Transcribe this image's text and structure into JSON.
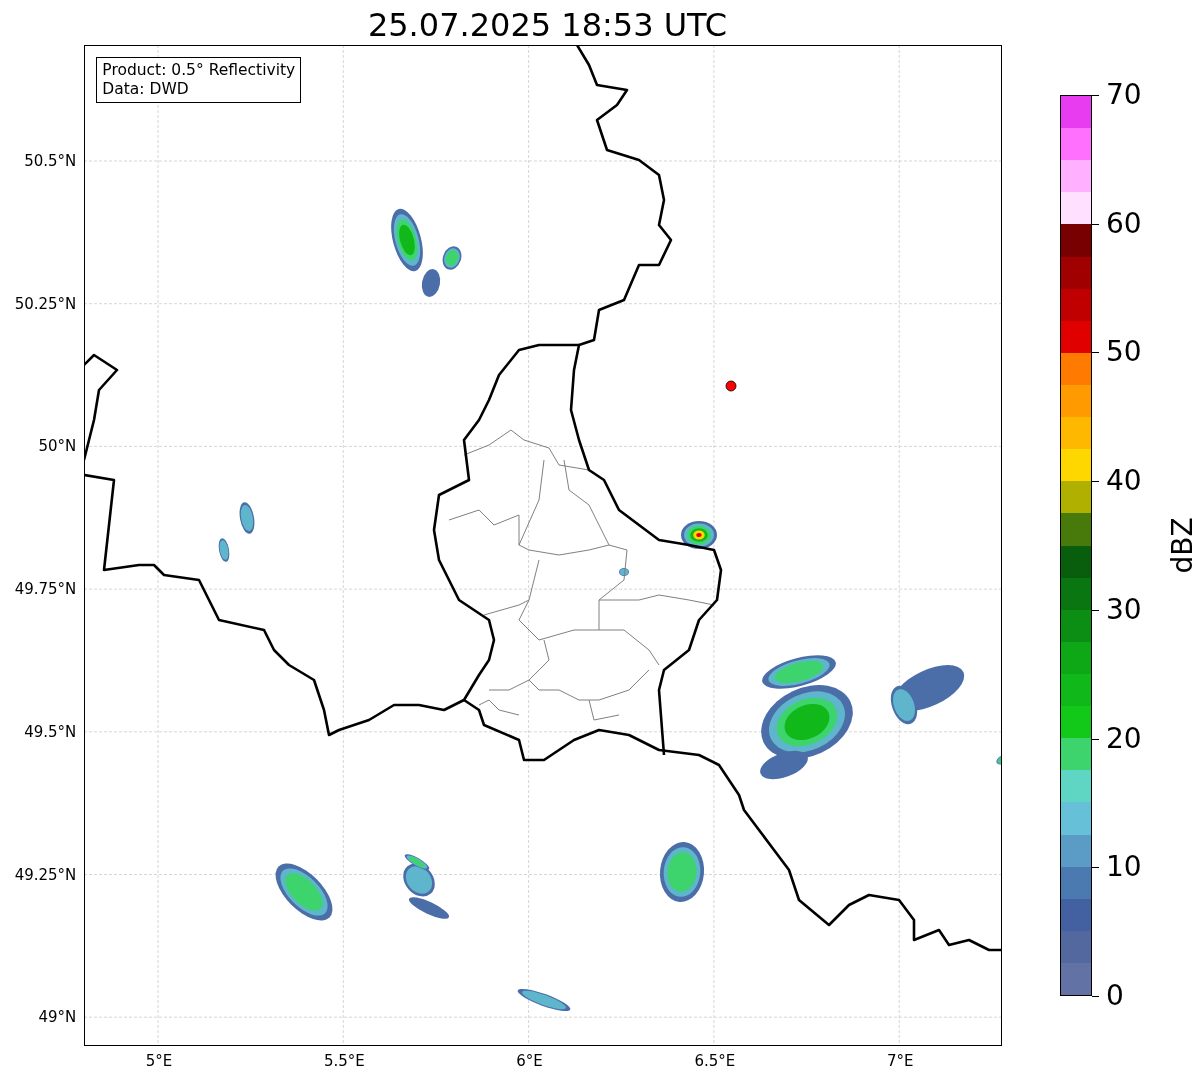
{
  "title": "25.07.2025 18:53 UTC",
  "map": {
    "legend": [
      "Product: 0.5° Reflectivity",
      "Data: DWD"
    ],
    "lat_ticks": [
      "50.5°N",
      "50.25°N",
      "50°N",
      "49.75°N",
      "49.5°N",
      "49.25°N",
      "49°N"
    ],
    "lon_ticks": [
      "5°E",
      "5.5°E",
      "6°E",
      "6.5°E",
      "7°E"
    ]
  },
  "colorbar": {
    "label": "dBZ",
    "ticks": [
      "70",
      "60",
      "50",
      "40",
      "30",
      "20",
      "10",
      "0"
    ],
    "bands": [
      {
        "color": "#e83cf0"
      },
      {
        "color": "#ff70ff"
      },
      {
        "color": "#ffb0ff"
      },
      {
        "color": "#ffe0ff"
      },
      {
        "color": "#780000"
      },
      {
        "color": "#a00000"
      },
      {
        "color": "#c00000"
      },
      {
        "color": "#e00000"
      },
      {
        "color": "#ff7a00"
      },
      {
        "color": "#ff9a00"
      },
      {
        "color": "#ffb800"
      },
      {
        "color": "#ffd700"
      },
      {
        "color": "#b0b000"
      },
      {
        "color": "#477a0b"
      },
      {
        "color": "#095e0e"
      },
      {
        "color": "#0a7612"
      },
      {
        "color": "#0c8e14"
      },
      {
        "color": "#0ea816"
      },
      {
        "color": "#10b81a"
      },
      {
        "color": "#12c818"
      },
      {
        "color": "#3dd46e"
      },
      {
        "color": "#5fd6c4"
      },
      {
        "color": "#65c0d8"
      },
      {
        "color": "#5b9cc6"
      },
      {
        "color": "#4a7ab0"
      },
      {
        "color": "#4360a0"
      },
      {
        "color": "#52689e"
      },
      {
        "color": "#6272a4"
      }
    ]
  }
}
